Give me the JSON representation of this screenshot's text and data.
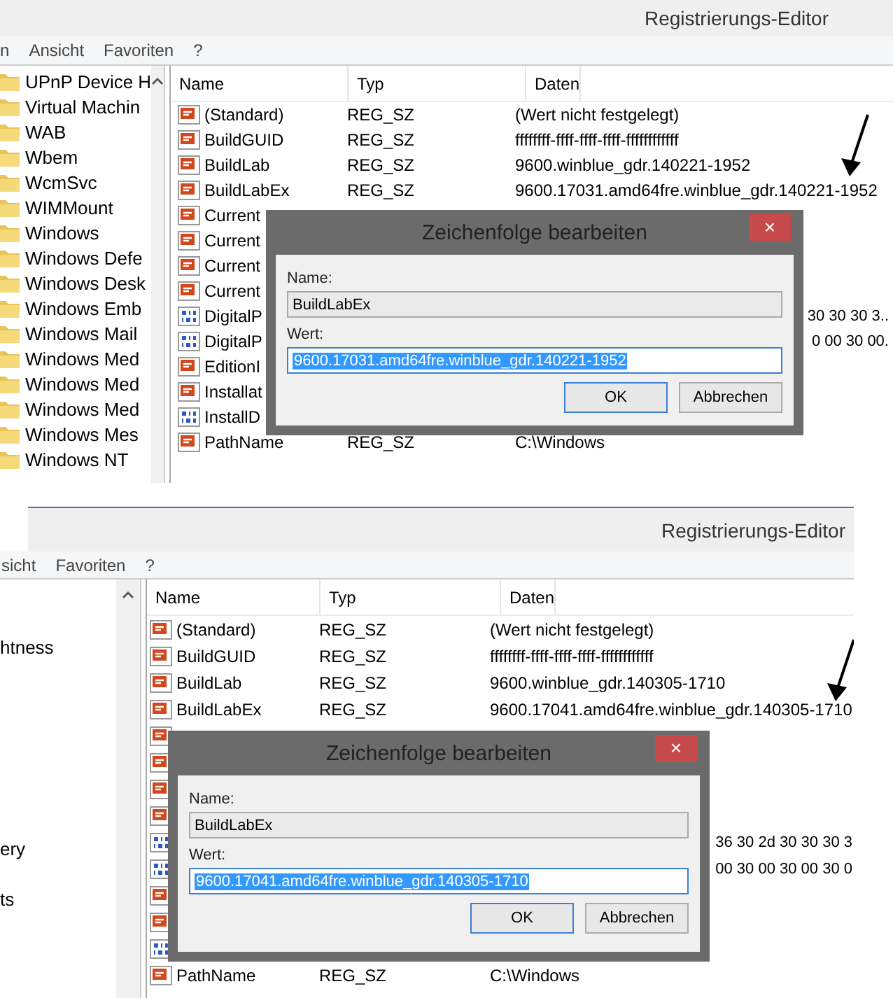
{
  "screenshots": [
    {
      "title": "Registrierungs-Editor",
      "menu": [
        "n",
        "Ansicht",
        "Favoriten",
        "?"
      ],
      "tree_icons": true,
      "tree": [
        {
          "label": "UPnP Device H"
        },
        {
          "label": "Virtual Machin"
        },
        {
          "label": "WAB"
        },
        {
          "label": "Wbem"
        },
        {
          "label": "WcmSvc"
        },
        {
          "label": "WIMMount"
        },
        {
          "label": "Windows"
        },
        {
          "label": "Windows Defe"
        },
        {
          "label": "Windows Desk"
        },
        {
          "label": "Windows Emb"
        },
        {
          "label": "Windows Mail"
        },
        {
          "label": "Windows Med"
        },
        {
          "label": "Windows Med"
        },
        {
          "label": "Windows Med"
        },
        {
          "label": "Windows Mes"
        },
        {
          "label": "Windows NT"
        }
      ],
      "columns": [
        "Name",
        "Typ",
        "Daten"
      ],
      "rows": [
        {
          "kind": "string",
          "name": "(Standard)",
          "type": "REG_SZ",
          "data": "(Wert nicht festgelegt)"
        },
        {
          "kind": "string",
          "name": "BuildGUID",
          "type": "REG_SZ",
          "data": "ffffffff-ffff-ffff-ffff-ffffffffffff"
        },
        {
          "kind": "string",
          "name": "BuildLab",
          "type": "REG_SZ",
          "data": "9600.winblue_gdr.140221-1952"
        },
        {
          "kind": "string",
          "name": "BuildLabEx",
          "type": "REG_SZ",
          "data": "9600.17031.amd64fre.winblue_gdr.140221-1952"
        },
        {
          "kind": "string",
          "name": "Current"
        },
        {
          "kind": "string",
          "name": "Current"
        },
        {
          "kind": "string",
          "name": "Current"
        },
        {
          "kind": "string",
          "name": "Current"
        },
        {
          "kind": "binary",
          "name": "DigitalP",
          "data": "30 30 30 3.."
        },
        {
          "kind": "binary",
          "name": "DigitalP",
          "data": "0 00 30 00."
        },
        {
          "kind": "string",
          "name": "EditionI"
        },
        {
          "kind": "string",
          "name": "Installat"
        },
        {
          "kind": "binary",
          "name": "InstallD"
        },
        {
          "kind": "string",
          "name": "PathName",
          "type": "REG_SZ",
          "data": "C:\\Windows"
        }
      ],
      "dialog": {
        "title": "Zeichenfolge bearbeiten",
        "close": "×",
        "name_label": "Name:",
        "name_value": "BuildLabEx",
        "value_label": "Wert:",
        "value": "9600.17031.amd64fre.winblue_gdr.140221-1952",
        "value_selected": true,
        "buttons": [
          {
            "label": "OK",
            "default": true
          },
          {
            "label": "Abbrechen",
            "default": false
          }
        ]
      }
    },
    {
      "title": "Registrierungs-Editor",
      "menu": [
        "sicht",
        "Favoriten",
        "?"
      ],
      "tree_icons": false,
      "tree": [
        {
          "label": "htness"
        },
        {
          "label": "ery"
        },
        {
          "label": "ts"
        }
      ],
      "columns": [
        "Name",
        "Typ",
        "Daten"
      ],
      "rows": [
        {
          "kind": "string",
          "name": "(Standard)",
          "type": "REG_SZ",
          "data": "(Wert nicht festgelegt)"
        },
        {
          "kind": "string",
          "name": "BuildGUID",
          "type": "REG_SZ",
          "data": "ffffffff-ffff-ffff-ffff-ffffffffffff"
        },
        {
          "kind": "string",
          "name": "BuildLab",
          "type": "REG_SZ",
          "data": "9600.winblue_gdr.140305-1710"
        },
        {
          "kind": "string",
          "name": "BuildLabEx",
          "type": "REG_SZ",
          "data": "9600.17041.amd64fre.winblue_gdr.140305-1710"
        },
        {
          "kind": "string"
        },
        {
          "kind": "string"
        },
        {
          "kind": "string"
        },
        {
          "kind": "string"
        },
        {
          "kind": "binary",
          "data": "36 30 2d 30 30 30 3"
        },
        {
          "kind": "binary",
          "data": "00 30 00 30 00 30 0"
        },
        {
          "kind": "string"
        },
        {
          "kind": "string"
        },
        {
          "kind": "binary"
        },
        {
          "kind": "string",
          "name": "PathName",
          "type": "REG_SZ",
          "data": "C:\\Windows"
        }
      ],
      "dialog": {
        "title": "Zeichenfolge bearbeiten",
        "close": "×",
        "name_label": "Name:",
        "name_value": "BuildLabEx",
        "value_label": "Wert:",
        "value": "9600.17041.amd64fre.winblue_gdr.140305-1710",
        "value_selected": true,
        "buttons": [
          {
            "label": "OK",
            "default": true
          },
          {
            "label": "Abbrechen",
            "default": false
          }
        ]
      }
    }
  ]
}
